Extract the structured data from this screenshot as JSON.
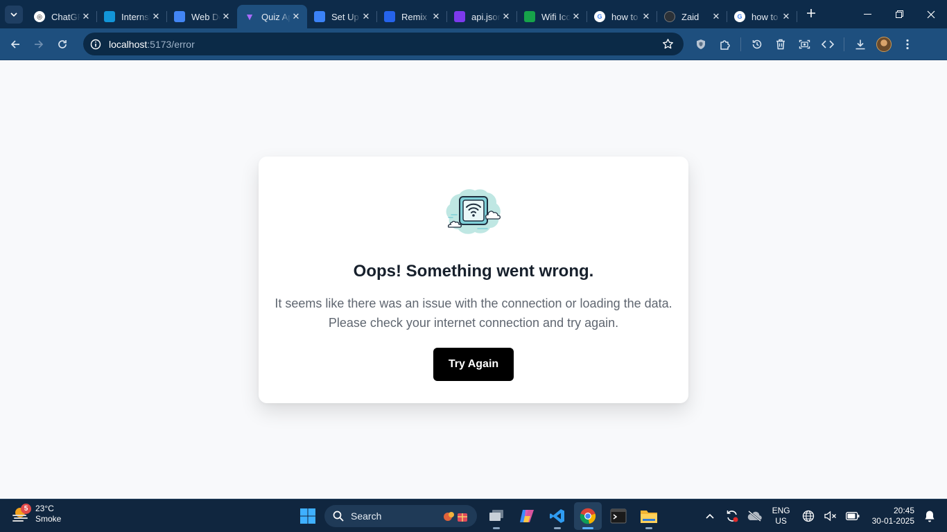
{
  "browser": {
    "tabs": [
      {
        "title": "ChatGPT",
        "icon": "chatgpt-icon",
        "color": "#ffffff"
      },
      {
        "title": "Internshala",
        "icon": "internshala-icon",
        "color": "#1295d8"
      },
      {
        "title": "Web Development",
        "icon": "google-docs-icon",
        "color": "#4285f4"
      },
      {
        "title": "Quiz App",
        "icon": "vite-icon",
        "color": "#a96bff",
        "active": true
      },
      {
        "title": "Set Up",
        "icon": "flag-icon",
        "color": "#3b82f6"
      },
      {
        "title": "Remix",
        "icon": "remix-icon",
        "color": "#2563eb"
      },
      {
        "title": "api.json",
        "icon": "api-icon",
        "color": "#7c3aed"
      },
      {
        "title": "Wifi Icon",
        "icon": "wifi-site-icon",
        "color": "#16a34a"
      },
      {
        "title": "how to",
        "icon": "google-icon",
        "color": "#ffffff"
      },
      {
        "title": "Zaid",
        "icon": "github-icon",
        "color": "#24292f"
      },
      {
        "title": "how to",
        "icon": "google-icon",
        "color": "#ffffff"
      }
    ],
    "url_host": "localhost",
    "url_path": ":5173/error"
  },
  "error": {
    "title": "Oops! Something went wrong.",
    "message_line1": "It seems like there was an issue with the connection or loading the data.",
    "message_line2": "Please check your internet connection and try again.",
    "button": "Try Again"
  },
  "taskbar": {
    "weather_badge": "5",
    "temperature": "23°C",
    "condition": "Smoke",
    "search_label": "Search",
    "lang_line1": "ENG",
    "lang_line2": "US",
    "time": "20:45",
    "date": "30-01-2025"
  },
  "colors": {
    "tabstrip": "#0d2b4a",
    "toolbar": "#1e4f7e",
    "button": "#000000",
    "page_bg": "#f8f9fb"
  }
}
